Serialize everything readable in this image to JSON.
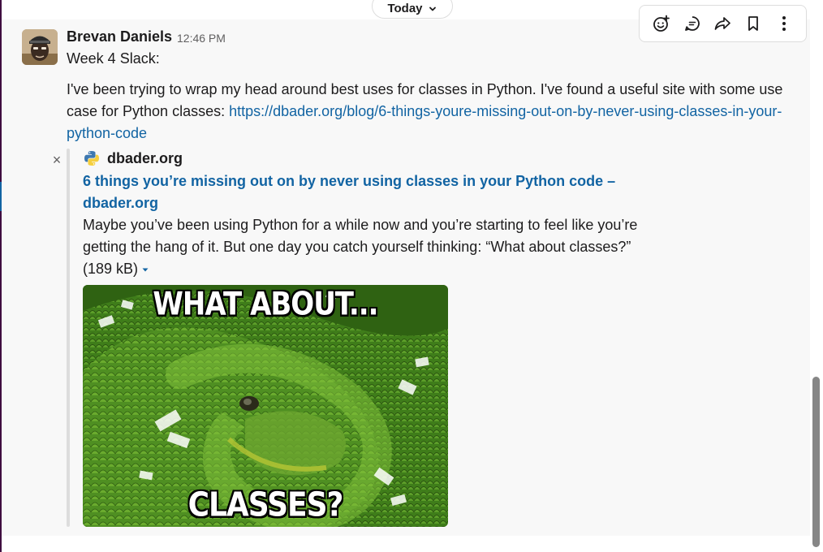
{
  "divider": {
    "date_label": "Today"
  },
  "message": {
    "sender": "Brevan Daniels",
    "timestamp": "12:46 PM",
    "line1": "Week 4 Slack:",
    "body_prefix": "I've been trying to wrap my head around best uses for classes in Python. I've found a useful site with some use case for Python classes: ",
    "link_url": "https://dbader.org/blog/6-things-youre-missing-out-on-by-never-using-classes-in-your-python-code"
  },
  "toolbar": {
    "icons": [
      "add-reaction-icon",
      "reply-in-thread-icon",
      "share-message-icon",
      "save-bookmark-icon",
      "more-actions-icon"
    ]
  },
  "unfurl": {
    "close_symbol": "×",
    "site": "dbader.org",
    "title": "6 things you’re missing out on by never using classes in your Python code – dbader.org",
    "description": "Maybe you’ve been using Python for a while now and you’re starting to feel like you’re getting the hang of it. But one day you catch yourself thinking: “What about classes?”",
    "size": "(189 kB)",
    "image": {
      "top_text": "WHAT ABOUT...",
      "bottom_text": "CLASSES?"
    }
  },
  "colors": {
    "link": "#1264a3",
    "text": "#1d1c1d",
    "muted": "#616061",
    "message_bg": "#f8f8f8"
  }
}
